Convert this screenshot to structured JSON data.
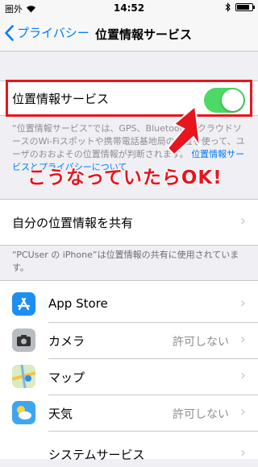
{
  "status_bar": {
    "carrier": "圏外",
    "time": "14:52",
    "battery_level": 0.85
  },
  "nav": {
    "back_label": "プライバシー",
    "title": "位置情報サービス"
  },
  "location_services": {
    "label": "位置情報サービス",
    "enabled": true,
    "description": "“位置情報サービス”では、GPS、Bluetooth、クラウドソースのWi-Fiスポットや携帯電話基地局の位置を使って、ユーザのおおよその位置情報が判断されます。",
    "link": "位置情報サービスとプライバシーについて"
  },
  "annotation": {
    "text": "こうなっていたらOK!"
  },
  "share": {
    "label": "自分の位置情報を共有",
    "note": "“PCUser の iPhone”は位置情報の共有に使用されています。"
  },
  "apps": [
    {
      "name": "App Store",
      "status": "",
      "icon": "app-store-icon"
    },
    {
      "name": "カメラ",
      "status": "許可しない",
      "icon": "camera-icon"
    },
    {
      "name": "マップ",
      "status": "",
      "icon": "maps-icon"
    },
    {
      "name": "天気",
      "status": "許可しない",
      "icon": "weather-icon"
    },
    {
      "name": "システムサービス",
      "status": "",
      "icon": "system-services-icon"
    }
  ],
  "colors": {
    "accent": "#007aff",
    "toggle_on": "#4cd964",
    "highlight": "#e8141e"
  }
}
